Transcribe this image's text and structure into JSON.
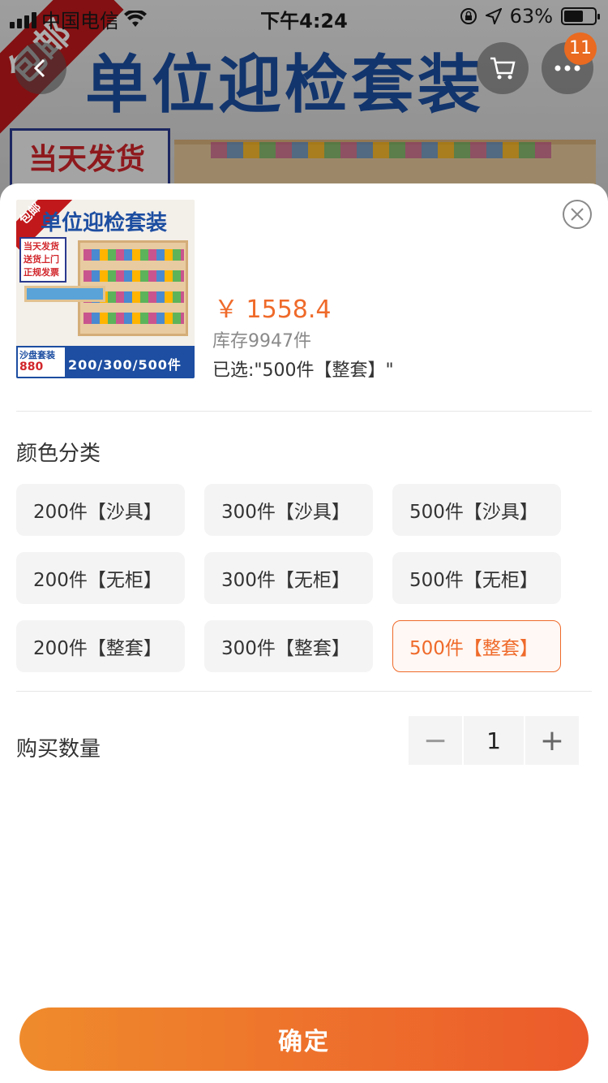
{
  "status_bar": {
    "carrier": "中国电信",
    "time": "下午4:24",
    "battery": "63%",
    "battery_level": 0.63
  },
  "background_page": {
    "banner_title": "单位迎检套装",
    "ribbon_text": "包邮",
    "box_text": "当天发货",
    "cart_badge": "11"
  },
  "product": {
    "thumb": {
      "ribbon": "包邮",
      "title": "单位迎检套装",
      "tags": [
        "当天发货",
        "送货上门",
        "正规发票"
      ],
      "bottom_left_line1": "沙盘套装",
      "bottom_left_line2": "880",
      "bottom_right": "200/300/500件"
    },
    "price": "￥ 1558.4",
    "stock": "库存9947件",
    "selected": "已选:\"500件【整套】\""
  },
  "color_section": {
    "title": "颜色分类",
    "options": [
      "200件【沙具】",
      "300件【沙具】",
      "500件【沙具】",
      "200件【无柜】",
      "300件【无柜】",
      "500件【无柜】",
      "200件【整套】",
      "300件【整套】",
      "500件【整套】"
    ],
    "selected": "500件【整套】"
  },
  "quantity_section": {
    "title": "购买数量",
    "minus": "−",
    "value": "1",
    "plus": "+"
  },
  "confirm_button": "确定",
  "colors": {
    "accent": "#ef6a2a",
    "button_start": "#ef8b2c",
    "button_end": "#ec5a2b"
  }
}
